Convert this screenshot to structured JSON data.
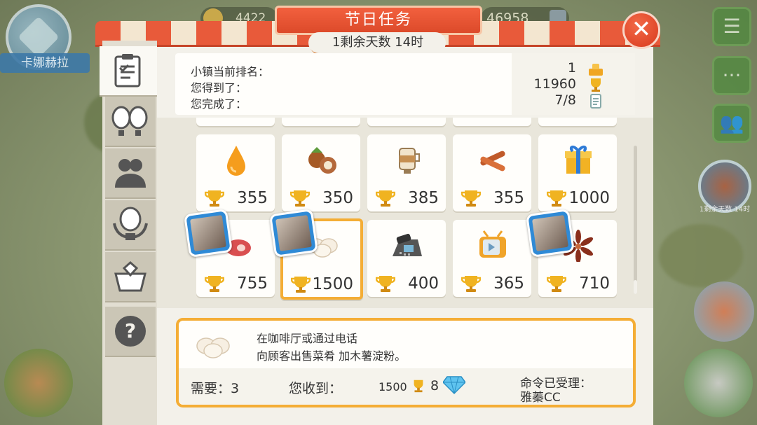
{
  "window": {
    "title": "节日任务",
    "timer": "1剩余天数 14时",
    "close_icon": "close-icon"
  },
  "hud": {
    "player_name": "卡娜赫拉",
    "coins": "4422",
    "gems": "46958",
    "side_caption": "1剩余天数 14时"
  },
  "tabs": [
    {
      "name": "tasks-tab",
      "icon": "clipboard-icon",
      "active": true
    },
    {
      "name": "balloons-tab",
      "icon": "balloons-icon",
      "active": false
    },
    {
      "name": "players-tab",
      "icon": "people-icon",
      "active": false
    },
    {
      "name": "ranking-tab",
      "icon": "balloon-laurel-icon",
      "active": false
    },
    {
      "name": "rewards-tab",
      "icon": "gem-basket-icon",
      "active": false
    },
    {
      "name": "help-tab",
      "icon": "question-icon",
      "active": false
    }
  ],
  "summary": {
    "rank_label": "小镇当前排名：",
    "rank_value": "1",
    "earned_label": "您得到了：",
    "earned_value": "11960",
    "completed_label": "您完成了：",
    "completed_value": "7/8"
  },
  "items": [
    {
      "name": "oil-drop",
      "icon": "oil-drop-icon",
      "points": "355",
      "selected": false,
      "has_badge": false
    },
    {
      "name": "hazelnut",
      "icon": "hazelnut-icon",
      "points": "350",
      "selected": false,
      "has_badge": false
    },
    {
      "name": "latte",
      "icon": "latte-icon",
      "points": "385",
      "selected": false,
      "has_badge": false
    },
    {
      "name": "cinnamon",
      "icon": "cinnamon-icon",
      "points": "355",
      "selected": false,
      "has_badge": false
    },
    {
      "name": "gift-box",
      "icon": "gift-box-icon",
      "points": "1000",
      "selected": false,
      "has_badge": false
    },
    {
      "name": "ham",
      "icon": "ham-icon",
      "points": "755",
      "selected": false,
      "has_badge": true
    },
    {
      "name": "tapioca-starch",
      "icon": "eggs-icon",
      "points": "1500",
      "selected": true,
      "has_badge": true
    },
    {
      "name": "phone",
      "icon": "phone-icon",
      "points": "400",
      "selected": false,
      "has_badge": false
    },
    {
      "name": "television",
      "icon": "tv-icon",
      "points": "365",
      "selected": false,
      "has_badge": false
    },
    {
      "name": "star-anise",
      "icon": "star-anise-icon",
      "points": "710",
      "selected": false,
      "has_badge": true
    }
  ],
  "detail": {
    "line1": "在咖啡厅或通过电话",
    "line2": "向顾客出售菜肴 加木薯淀粉。",
    "required_label": "需要：3",
    "received_label": "您收到：",
    "reward_points": "1500",
    "reward_gems": "8",
    "accepted_label": "命令已受理：",
    "accepted_by": "雅蓁CC"
  },
  "colors": {
    "accent": "#f4ad35",
    "title": "#e4522f",
    "panel": "#f3f1ea"
  }
}
